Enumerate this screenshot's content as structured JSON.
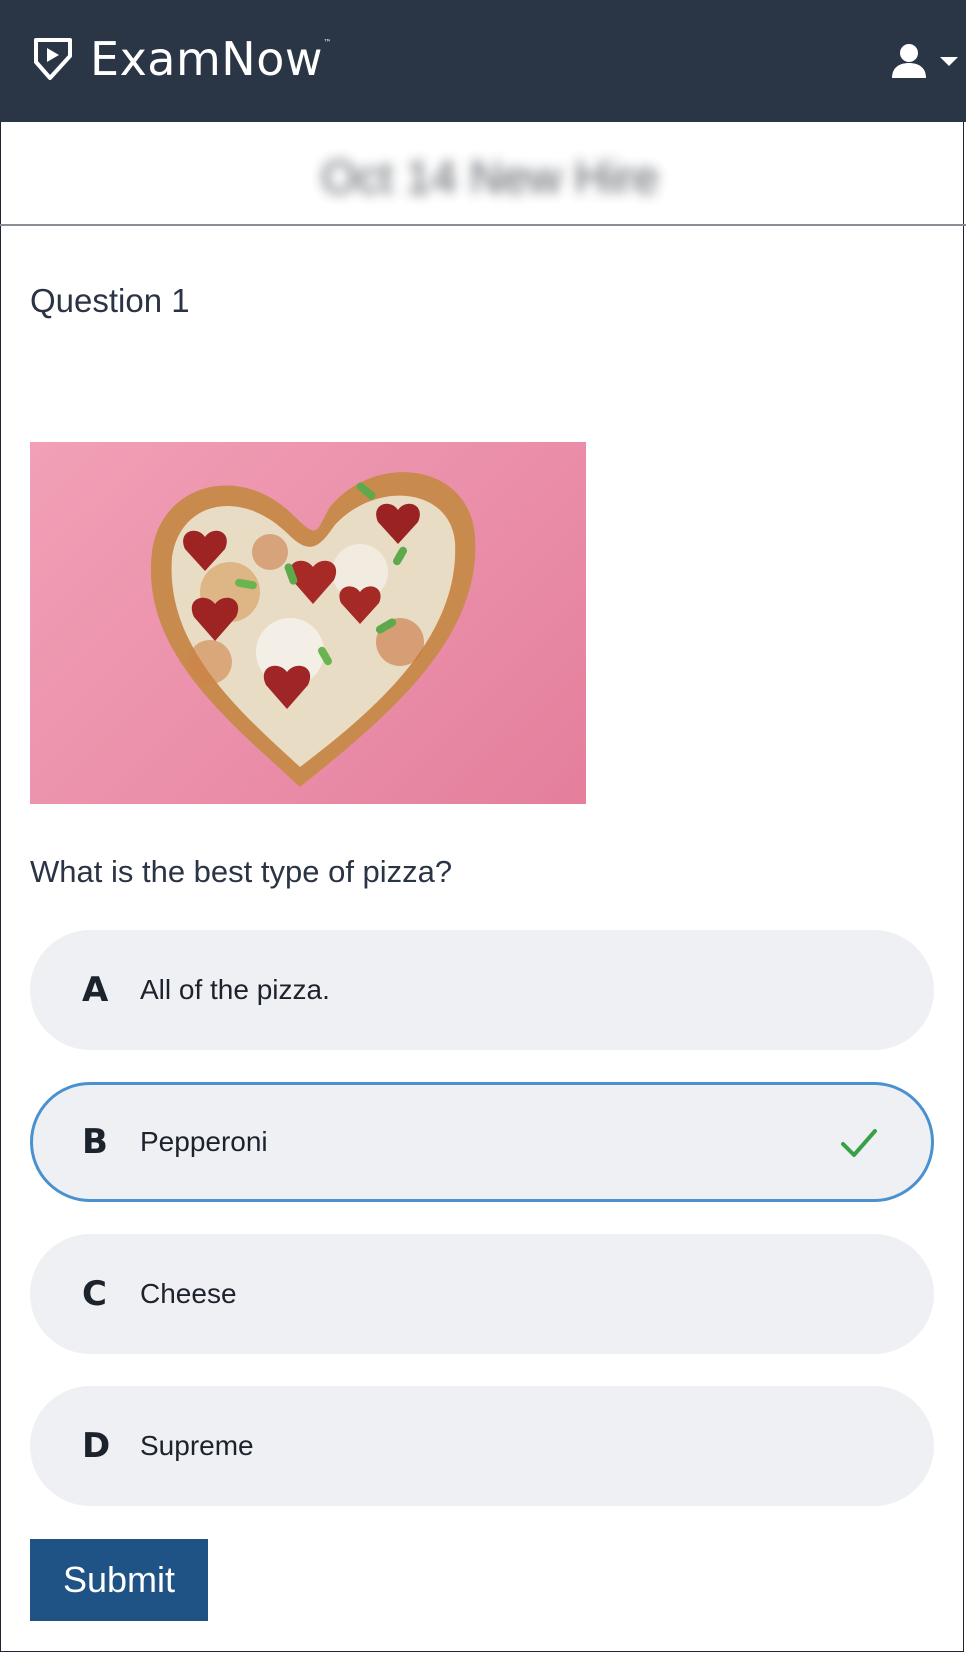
{
  "header": {
    "app_name": "ExamNow",
    "trademark": "™",
    "logo_icon": "play-shield-icon",
    "user_icon": "user-icon",
    "menu_icon": "caret-down-icon",
    "background_color": "#2a3546"
  },
  "exam": {
    "title": "Oct 14 New Hire"
  },
  "question": {
    "heading": "Question 1",
    "image_alt": "heart-shaped pepperoni pizza",
    "prompt": "What is the best type of pizza?",
    "options": [
      {
        "letter": "A",
        "text": "All of the pizza.",
        "selected": false
      },
      {
        "letter": "B",
        "text": "Pepperoni",
        "selected": true
      },
      {
        "letter": "C",
        "text": "Cheese",
        "selected": false
      },
      {
        "letter": "D",
        "text": "Supreme",
        "selected": false
      }
    ],
    "selected_indicator_icon": "checkmark-icon",
    "selected_border_color": "#4a92cf",
    "check_color": "#3aa048"
  },
  "actions": {
    "submit_label": "Submit",
    "submit_color": "#1f5385"
  }
}
